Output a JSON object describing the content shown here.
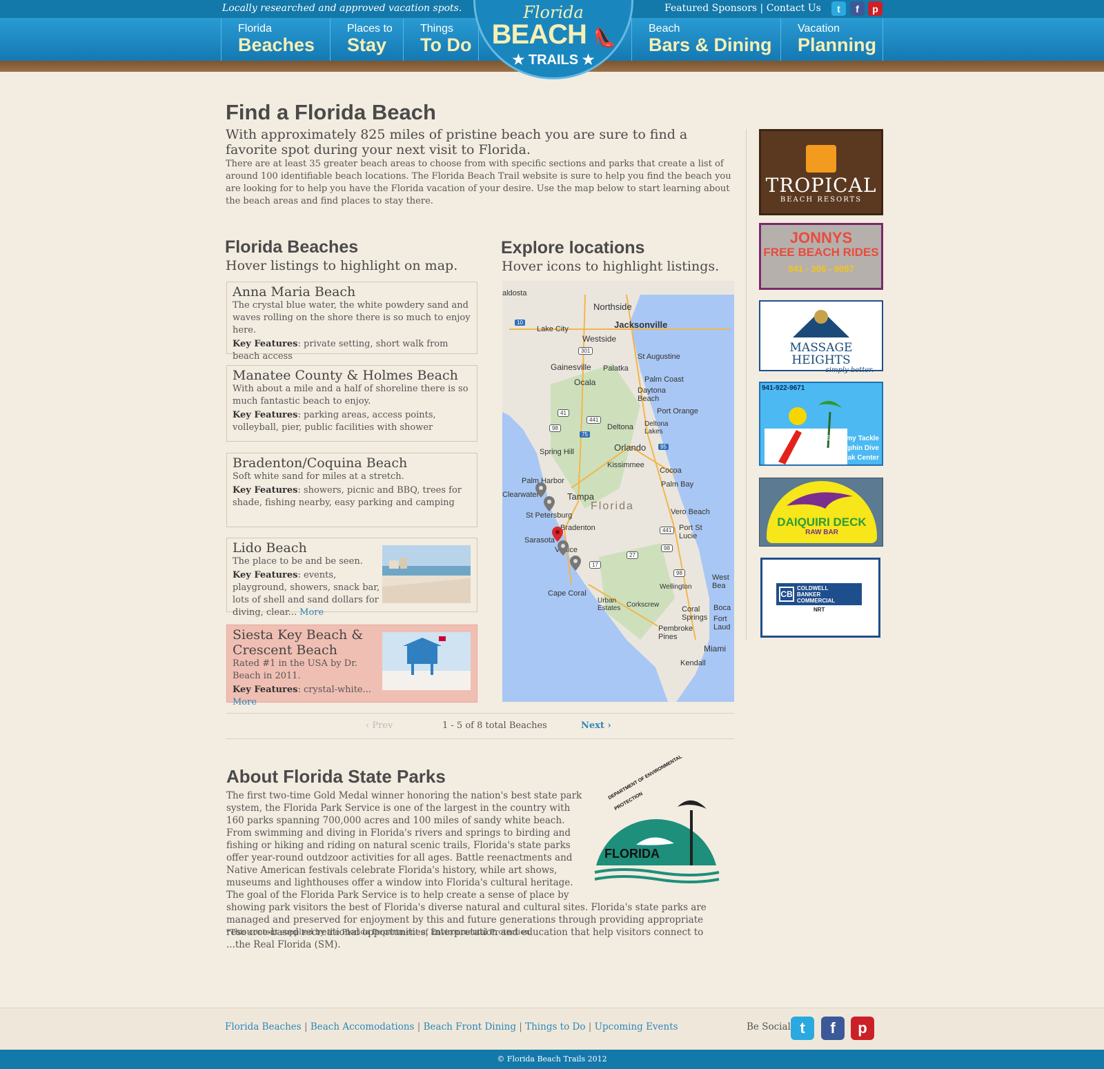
{
  "header": {
    "tagline": "Locally researched and approved vacation spots.",
    "featured_sponsors": "Featured Sponsors",
    "separator": " | ",
    "contact_us": "Contact Us",
    "logo": {
      "line1": "Florida",
      "line2": "BEACH",
      "line3": "TRAILS"
    },
    "nav": [
      {
        "small": "Florida",
        "big": "Beaches"
      },
      {
        "small": "Places to",
        "big": "Stay"
      },
      {
        "small": "Things",
        "big": "To Do"
      },
      {
        "small": "Beach",
        "big": "Bars & Dining"
      },
      {
        "small": "Vacation",
        "big": "Planning"
      }
    ],
    "social_icons": [
      "twitter-icon",
      "facebook-icon",
      "pinterest-icon"
    ]
  },
  "main": {
    "title": "Find a Florida Beach",
    "lead": "With approximately 825 miles of pristine beach you are sure to find a favorite spot during your next visit to Florida.",
    "intro": "There are at least 35 greater beach areas to choose from with specific sections and parks that create a list of around 100 identifiable beach locations. The Florida Beach Trail website is sure to help you find the beach you are looking for to help you have the Florida vacation of your desire. Use the map below to start learning about the beach areas and find places to stay there."
  },
  "beaches": {
    "heading": "Florida Beaches",
    "subheading": "Hover listings to highlight on map.",
    "key_label": "Key Features",
    "more_label": "More",
    "items": [
      {
        "title": "Anna Maria Beach",
        "desc": "The crystal blue water, the white powdery sand and waves rolling on the shore there is so much to enjoy here.",
        "features": ": private setting, short walk from beach access"
      },
      {
        "title": "Manatee County & Holmes Beach",
        "desc": "With about a mile and a half of shoreline there is so much fantastic beach to enjoy.",
        "features": ": parking areas, access points, volleyball, pier, public facilities with shower"
      },
      {
        "title": "Bradenton/Coquina Beach",
        "desc": "Soft white sand for miles at a stretch.",
        "features": ": showers, picnic and BBQ, trees for shade, fishing nearby, easy parking and camping"
      },
      {
        "title": "Lido Beach",
        "desc": "The place to be and be seen.",
        "features": ": events, playground, showers, snack bar, lots of shell and sand dollars for diving, clear... "
      },
      {
        "title": "Siesta Key Beach & Crescent Beach",
        "desc": "Rated #1 in the USA by Dr. Beach in 2011.",
        "features": ": crystal-white... "
      }
    ]
  },
  "map": {
    "heading": "Explore locations",
    "subheading": "Hover icons to highlight listings.",
    "labels": [
      "Northside",
      "Jacksonville",
      "Lake City",
      "Westside",
      "St Augustine",
      "Gainesville",
      "Palatka",
      "Palm Coast",
      "Daytona Beach",
      "Ocala",
      "Port Orange",
      "Deltona",
      "Deltona Lakes",
      "Spring Hill",
      "Orlando",
      "Kissimmee",
      "Cocoa",
      "Palm Harbor",
      "Palm Bay",
      "Clearwater",
      "Tampa",
      "Florida",
      "St Petersburg",
      "Vero Beach",
      "Bradenton",
      "Port St Lucie",
      "Sarasota",
      "Venice",
      "Wellington",
      "Cape Coral",
      "Urban Estates",
      "Corkscrew",
      "Coral Springs",
      "Pembroke Pines",
      "Fort Laud",
      "Miami",
      "Kendall",
      "Boca",
      "West Bea",
      "aldosta"
    ],
    "highways": [
      "10",
      "301",
      "41",
      "441",
      "98",
      "75",
      "95",
      "441",
      "98",
      "27",
      "17",
      "98"
    ]
  },
  "pager": {
    "prev": "Prev",
    "status": "1 - 5 of 8 total Beaches",
    "next": "Next"
  },
  "ads": [
    {
      "name": "Tropical Beach Resorts",
      "line1": "TROPICAL",
      "line2": "BEACH RESORTS"
    },
    {
      "name": "Jonnys Free Beach Rides",
      "line1": "JONNYS",
      "line2": "FREE BEACH RIDES",
      "phone": "941 - 306 - 9097"
    },
    {
      "name": "Massage Heights",
      "line1": "MASSAGE HEIGHTS",
      "line2": "simply better."
    },
    {
      "name": "Economy Tackle",
      "phone": "941-922-9671",
      "line1": "Economy Tackle",
      "line2": "Dolphin Dive",
      "line3": "& Kayak Center"
    },
    {
      "name": "Daiquiri Deck",
      "line1": "DAIQUIRI DECK",
      "line2": "RAW BAR"
    },
    {
      "name": "Coldwell Banker Commercial",
      "line1": "COLDWELL",
      "line2": "BANKER",
      "line3": "COMMERCIAL",
      "line4": "NRT"
    }
  ],
  "parks": {
    "heading": "About Florida State Parks",
    "body": "The first two-time Gold Medal winner honoring the nation's best state park system, the Florida Park Service is one of the largest in the country with 160 parks spanning 700,000 acres and 100 miles of sandy white beach. From swimming and diving in Florida's rivers and springs to birding and fishing or hiking and riding on natural scenic trails, Florida's state parks offer year-round outdzoor activities for all ages. Battle reenactments and Native American festivals celebrate Florida's history, while art shows, museums and lighthouses offer a window into Florida's cultural heritage. The goal of the Florida Park Service is to help create a sense of place by showing park visitors the best of Florida's diverse natural and cultural sites. Florida's state parks are managed and preserved for enjoyment by this and future generations through providing appropriate resource-based recreational opportunities, interpretation and education that help visitors connect to ...the Real Florida (SM).",
    "note": "*This content supplied by the Florida Department of Environmental Protection.",
    "logo_text": "DEPARTMENT OF ENVIRONMENTAL PROTECTION",
    "logo_state": "FLORIDA"
  },
  "footer": {
    "links": [
      "Florida Beaches",
      "Beach Accomodations",
      "Beach Front Dining",
      "Things to Do",
      "Upcoming Events"
    ],
    "be_social": "Be Social",
    "copyright": "© Florida Beach Trails 2012"
  },
  "colors": {
    "header_blue": "#1378aa",
    "nav_text": "#f7efb4",
    "link": "#2e86b8",
    "highlight": "#f0bfb3",
    "background": "#f3ece0"
  }
}
